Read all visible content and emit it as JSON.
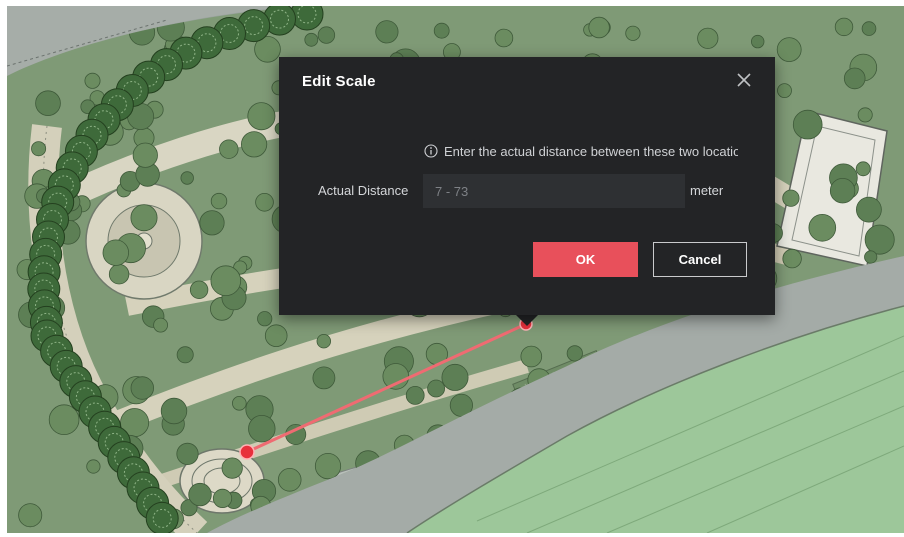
{
  "dialog": {
    "title": "Edit Scale",
    "hint": "Enter the actual distance between these two locations.",
    "field_label": "Actual Distance",
    "input_value": "",
    "input_placeholder": "7 - 73",
    "unit": "meter",
    "ok_label": "OK",
    "cancel_label": "Cancel",
    "close_icon": "close-icon",
    "info_icon": "info-icon"
  },
  "colors": {
    "dialog_bg": "#232426",
    "input_bg": "#2e3033",
    "ok_button": "#e8505b",
    "scale_line": "#ef6b72",
    "scale_point": "#e8303c"
  }
}
